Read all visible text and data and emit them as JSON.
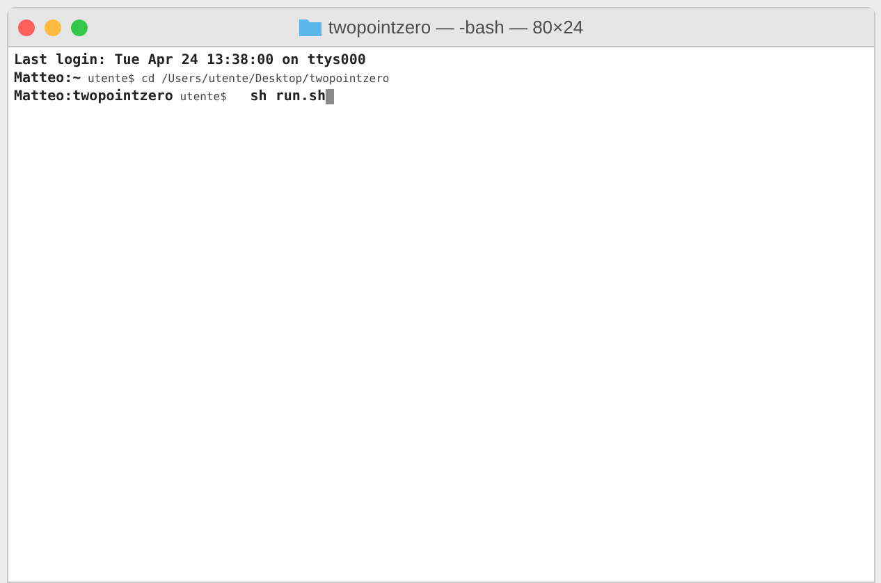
{
  "window": {
    "title": "twopointzero — -bash — 80×24"
  },
  "lines": [
    {
      "kind": "plain",
      "text": "Last login: Tue Apr 24 13:38:00 on ttys000"
    },
    {
      "kind": "prompt",
      "host": "Matteo:~",
      "user": "utente$",
      "command": "cd /Users/utente/Desktop/twopointzero",
      "cursor": false
    },
    {
      "kind": "prompt",
      "host": "Matteo:twopointzero",
      "user": "utente$",
      "command": "  sh run.sh",
      "cursor": true
    }
  ]
}
